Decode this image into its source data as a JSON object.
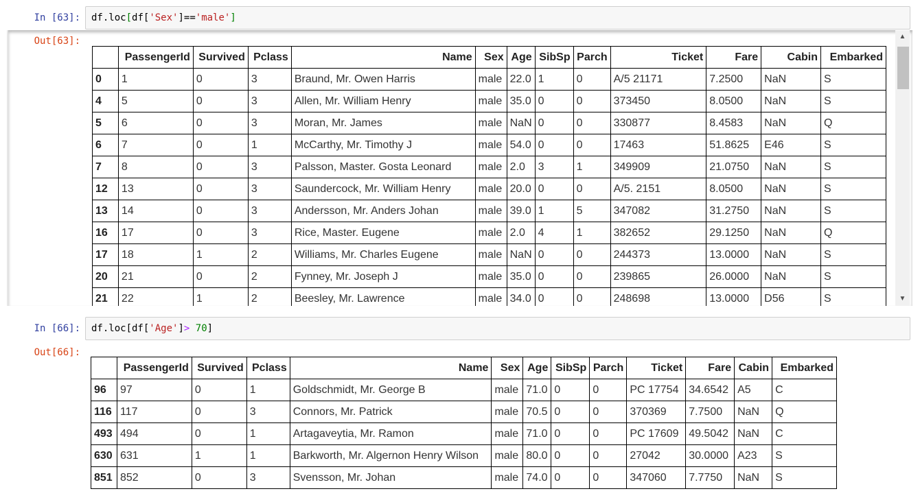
{
  "cells": [
    {
      "in_prompt": "In [63]:",
      "code_tokens": [
        {
          "text": "df.loc",
          "cls": "tok-plain"
        },
        {
          "text": "[",
          "cls": "tok-bracket"
        },
        {
          "text": "df[",
          "cls": "tok-plain"
        },
        {
          "text": "'Sex'",
          "cls": "tok-str"
        },
        {
          "text": "]==",
          "cls": "tok-plain"
        },
        {
          "text": "'male'",
          "cls": "tok-str"
        },
        {
          "text": "]",
          "cls": "tok-bracket"
        }
      ],
      "out_prompt": "Out[63]:",
      "columns": [
        "PassengerId",
        "Survived",
        "Pclass",
        "Name",
        "Sex",
        "Age",
        "SibSp",
        "Parch",
        "Ticket",
        "Fare",
        "Cabin",
        "Embarked"
      ],
      "rows": [
        [
          "0",
          "1",
          "0",
          "3",
          "Braund, Mr. Owen Harris",
          "male",
          "22.0",
          "1",
          "0",
          "A/5 21171",
          "7.2500",
          "NaN",
          "S"
        ],
        [
          "4",
          "5",
          "0",
          "3",
          "Allen, Mr. William Henry",
          "male",
          "35.0",
          "0",
          "0",
          "373450",
          "8.0500",
          "NaN",
          "S"
        ],
        [
          "5",
          "6",
          "0",
          "3",
          "Moran, Mr. James",
          "male",
          "NaN",
          "0",
          "0",
          "330877",
          "8.4583",
          "NaN",
          "Q"
        ],
        [
          "6",
          "7",
          "0",
          "1",
          "McCarthy, Mr. Timothy J",
          "male",
          "54.0",
          "0",
          "0",
          "17463",
          "51.8625",
          "E46",
          "S"
        ],
        [
          "7",
          "8",
          "0",
          "3",
          "Palsson, Master. Gosta Leonard",
          "male",
          "2.0",
          "3",
          "1",
          "349909",
          "21.0750",
          "NaN",
          "S"
        ],
        [
          "12",
          "13",
          "0",
          "3",
          "Saundercock, Mr. William Henry",
          "male",
          "20.0",
          "0",
          "0",
          "A/5. 2151",
          "8.0500",
          "NaN",
          "S"
        ],
        [
          "13",
          "14",
          "0",
          "3",
          "Andersson, Mr. Anders Johan",
          "male",
          "39.0",
          "1",
          "5",
          "347082",
          "31.2750",
          "NaN",
          "S"
        ],
        [
          "16",
          "17",
          "0",
          "3",
          "Rice, Master. Eugene",
          "male",
          "2.0",
          "4",
          "1",
          "382652",
          "29.1250",
          "NaN",
          "Q"
        ],
        [
          "17",
          "18",
          "1",
          "2",
          "Williams, Mr. Charles Eugene",
          "male",
          "NaN",
          "0",
          "0",
          "244373",
          "13.0000",
          "NaN",
          "S"
        ],
        [
          "20",
          "21",
          "0",
          "2",
          "Fynney, Mr. Joseph J",
          "male",
          "35.0",
          "0",
          "0",
          "239865",
          "26.0000",
          "NaN",
          "S"
        ],
        [
          "21",
          "22",
          "1",
          "2",
          "Beesley, Mr. Lawrence",
          "male",
          "34.0",
          "0",
          "0",
          "248698",
          "13.0000",
          "D56",
          "S"
        ]
      ]
    },
    {
      "in_prompt": "In [66]:",
      "code_tokens": [
        {
          "text": "df.loc[df[",
          "cls": "tok-plain"
        },
        {
          "text": "'Age'",
          "cls": "tok-str"
        },
        {
          "text": "]",
          "cls": "tok-plain"
        },
        {
          "text": ">",
          "cls": "tok-op"
        },
        {
          "text": " ",
          "cls": "tok-plain"
        },
        {
          "text": "70",
          "cls": "tok-num"
        },
        {
          "text": "]",
          "cls": "tok-plain"
        }
      ],
      "out_prompt": "Out[66]:",
      "columns": [
        "PassengerId",
        "Survived",
        "Pclass",
        "Name",
        "Sex",
        "Age",
        "SibSp",
        "Parch",
        "Ticket",
        "Fare",
        "Cabin",
        "Embarked"
      ],
      "rows": [
        [
          "96",
          "97",
          "0",
          "1",
          "Goldschmidt, Mr. George B",
          "male",
          "71.0",
          "0",
          "0",
          "PC 17754",
          "34.6542",
          "A5",
          "C"
        ],
        [
          "116",
          "117",
          "0",
          "3",
          "Connors, Mr. Patrick",
          "male",
          "70.5",
          "0",
          "0",
          "370369",
          "7.7500",
          "NaN",
          "Q"
        ],
        [
          "493",
          "494",
          "0",
          "1",
          "Artagaveytia, Mr. Ramon",
          "male",
          "71.0",
          "0",
          "0",
          "PC 17609",
          "49.5042",
          "NaN",
          "C"
        ],
        [
          "630",
          "631",
          "1",
          "1",
          "Barkworth, Mr. Algernon Henry Wilson",
          "male",
          "80.0",
          "0",
          "0",
          "27042",
          "30.0000",
          "A23",
          "S"
        ],
        [
          "851",
          "852",
          "0",
          "3",
          "Svensson, Mr. Johan",
          "male",
          "74.0",
          "0",
          "0",
          "347060",
          "7.7750",
          "NaN",
          "S"
        ]
      ]
    }
  ]
}
